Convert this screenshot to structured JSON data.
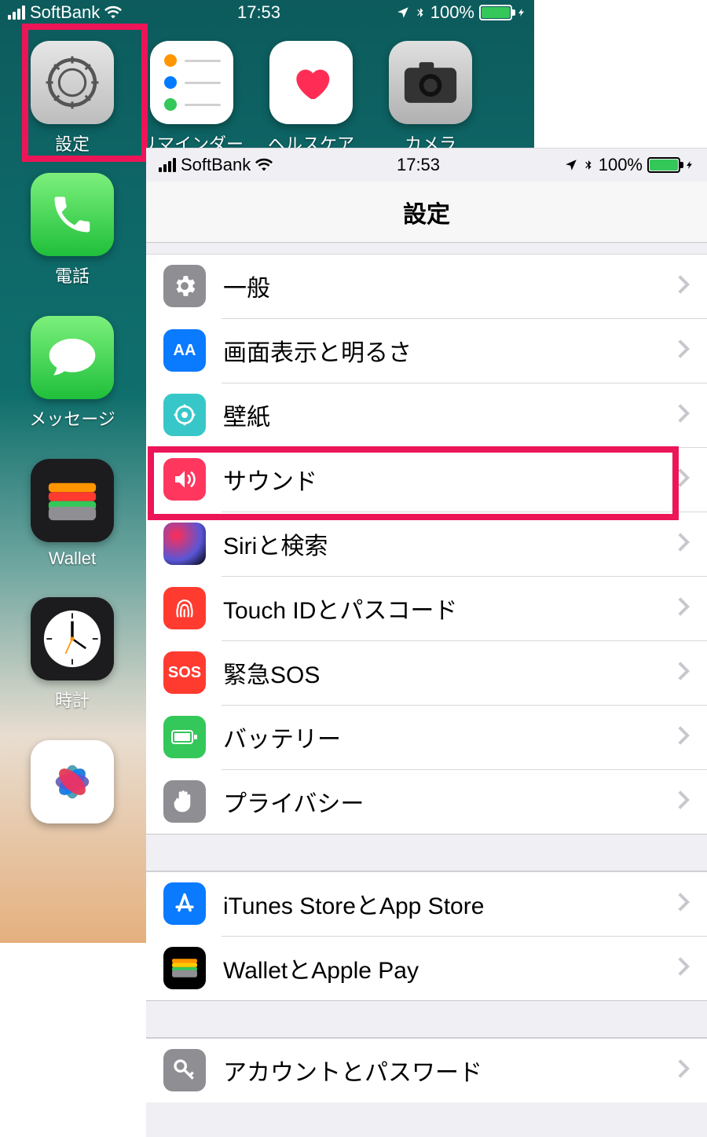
{
  "status": {
    "carrier": "SoftBank",
    "time": "17:53",
    "battery_pct": "100%"
  },
  "home_apps_row": [
    {
      "label": "設定"
    },
    {
      "label": "リマインダー"
    },
    {
      "label": "ヘルスケア"
    },
    {
      "label": "カメラ"
    }
  ],
  "home_apps_col": [
    {
      "label": "電話"
    },
    {
      "label": "メッセージ"
    },
    {
      "label": "Wallet"
    },
    {
      "label": "時計"
    },
    {
      "label": ""
    }
  ],
  "settings": {
    "title": "設定",
    "rows1": [
      {
        "label": "一般"
      },
      {
        "label": "画面表示と明るさ"
      },
      {
        "label": "壁紙"
      },
      {
        "label": "サウンド"
      },
      {
        "label": "Siriと検索"
      },
      {
        "label": "Touch IDとパスコード"
      },
      {
        "label": "緊急SOS"
      },
      {
        "label": "バッテリー"
      },
      {
        "label": "プライバシー"
      }
    ],
    "rows2": [
      {
        "label": "iTunes StoreとApp Store"
      },
      {
        "label": "WalletとApple Pay"
      }
    ],
    "rows3": [
      {
        "label": "アカウントとパスワード"
      }
    ],
    "sos_text": "SOS"
  }
}
